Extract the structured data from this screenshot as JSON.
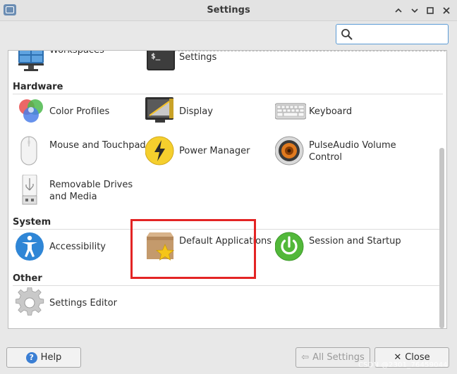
{
  "window": {
    "title": "Settings"
  },
  "search": {
    "placeholder": "",
    "value": ""
  },
  "partial_items": [
    {
      "label": "Workspaces"
    },
    {
      "label": "Xfce Terminal Settings"
    }
  ],
  "sections": {
    "hardware": {
      "title": "Hardware",
      "items": [
        {
          "label": "Color Profiles"
        },
        {
          "label": "Display"
        },
        {
          "label": "Keyboard"
        },
        {
          "label": "Mouse and Touchpad"
        },
        {
          "label": "Power Manager"
        },
        {
          "label": "PulseAudio Volume Control"
        },
        {
          "label": "Removable Drives and Media"
        }
      ]
    },
    "system": {
      "title": "System",
      "items": [
        {
          "label": "Accessibility"
        },
        {
          "label": "Default Applications"
        },
        {
          "label": "Session and Startup"
        }
      ]
    },
    "other": {
      "title": "Other",
      "items": [
        {
          "label": "Settings Editor"
        }
      ]
    }
  },
  "buttons": {
    "help": "Help",
    "all_settings": "All Settings",
    "close": "Close"
  },
  "watermark": "CSDN @2301_76459044",
  "colors": {
    "highlight": "#e32424",
    "accent": "#5b9bd5"
  }
}
